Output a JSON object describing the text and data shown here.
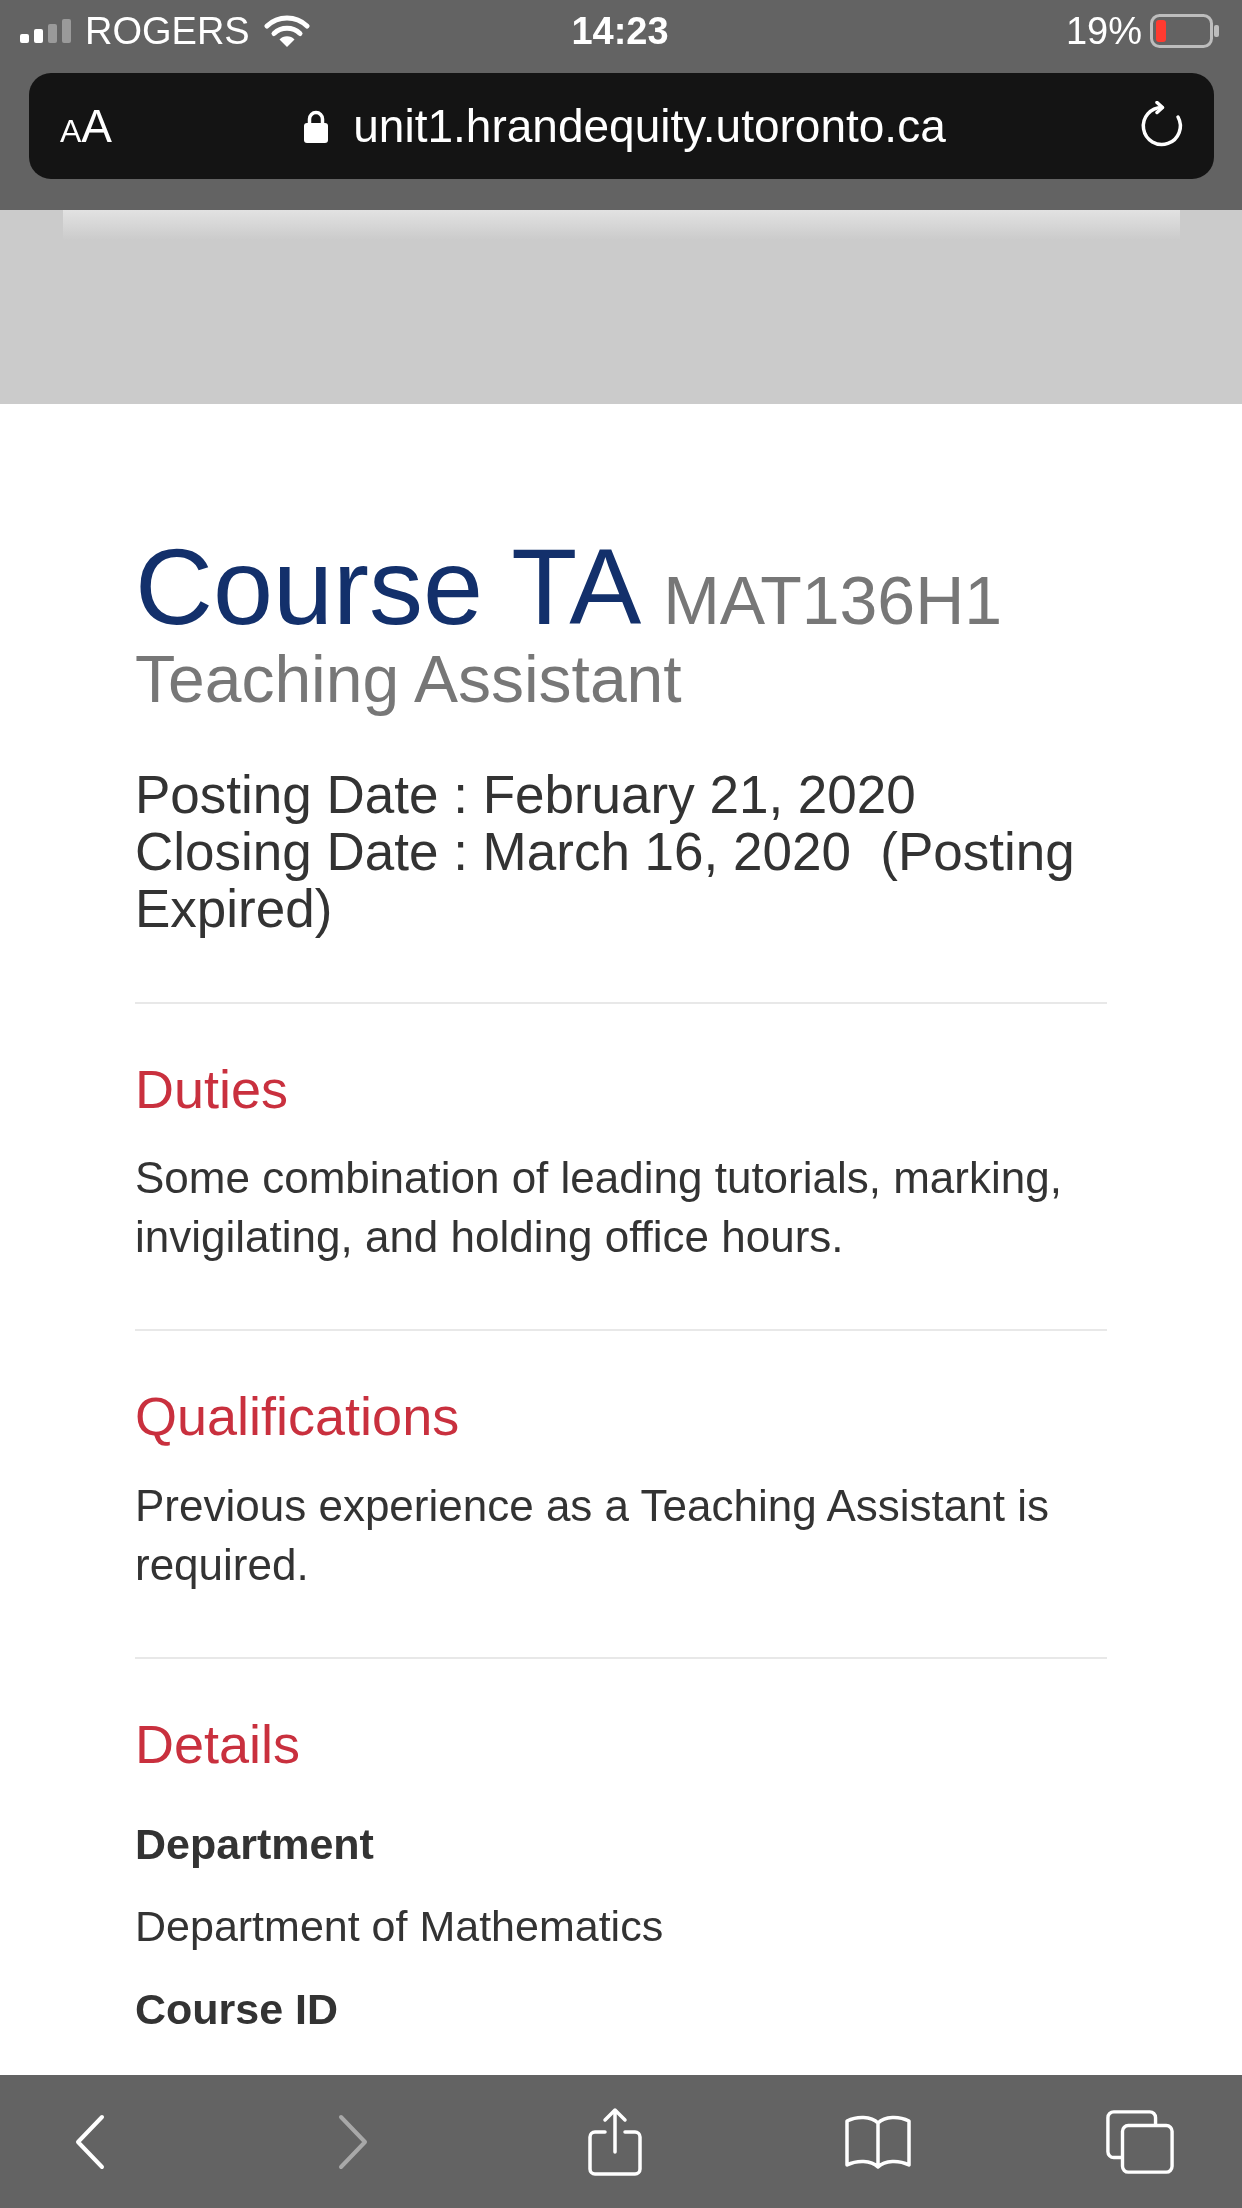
{
  "status_bar": {
    "carrier": "ROGERS",
    "time": "14:23",
    "battery": "19%"
  },
  "address_bar": {
    "text_size_label": "AA",
    "secure": true,
    "url": "unit1.hrandequity.utoronto.ca"
  },
  "posting": {
    "title": "Course TA",
    "code": "MAT136H1",
    "subtitle": "Teaching Assistant",
    "dates": [
      "Posting Date : February 21, 2020",
      "Closing Date : March 16, 2020  (Posting Expired)"
    ]
  },
  "sections": [
    {
      "kind": "paragraph",
      "heading": "Duties",
      "body": "Some combination of leading tutorials, marking, invigilating, and holding office hours."
    },
    {
      "kind": "paragraph",
      "heading": "Qualifications",
      "body": "Previous experience as a Teaching Assistant is required."
    },
    {
      "kind": "fields",
      "heading": "Details",
      "fields": [
        {
          "label": "Department",
          "value": "Department of Mathematics"
        },
        {
          "label": "Course ID"
        }
      ]
    }
  ],
  "toolbar": [
    {
      "kind": "back",
      "disabled": false
    },
    {
      "kind": "forward",
      "disabled": true
    },
    {
      "kind": "share",
      "disabled": false
    },
    {
      "kind": "bookmarks",
      "disabled": false
    },
    {
      "kind": "tabs",
      "disabled": false
    }
  ]
}
